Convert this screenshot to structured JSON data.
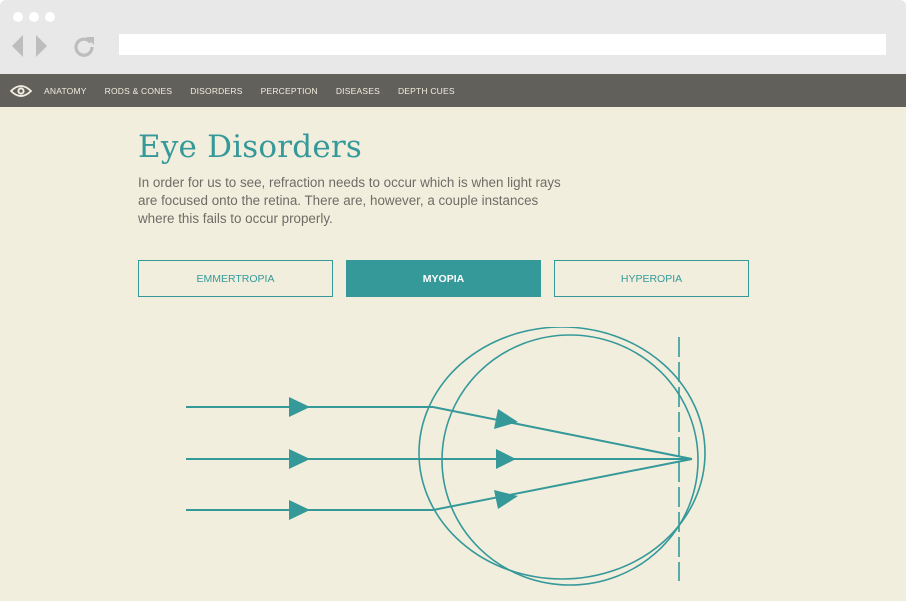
{
  "browser": {
    "address": ""
  },
  "nav": {
    "items": [
      {
        "label": "ANATOMY"
      },
      {
        "label": "RODS & CONES"
      },
      {
        "label": "DISORDERS"
      },
      {
        "label": "PERCEPTION"
      },
      {
        "label": "DISEASES"
      },
      {
        "label": "DEPTH CUES"
      }
    ]
  },
  "page": {
    "title": "Eye Disorders",
    "intro": "In order for us to see, refraction needs to occur which is when light rays are focused onto the retina. There are, however, a couple instances where this fails to occur properly."
  },
  "tabs": [
    {
      "label": "EMMERTROPIA",
      "active": false
    },
    {
      "label": "MYOPIA",
      "active": true
    },
    {
      "label": "HYPEROPIA",
      "active": false
    }
  ],
  "colors": {
    "accent": "#35999a",
    "background": "#f2eedd",
    "nav_bar": "#62605a",
    "text": "#6f6c66"
  },
  "icons": {
    "logo": "eye-icon",
    "back": "back-arrow-icon",
    "forward": "forward-arrow-icon",
    "reload": "reload-icon"
  }
}
